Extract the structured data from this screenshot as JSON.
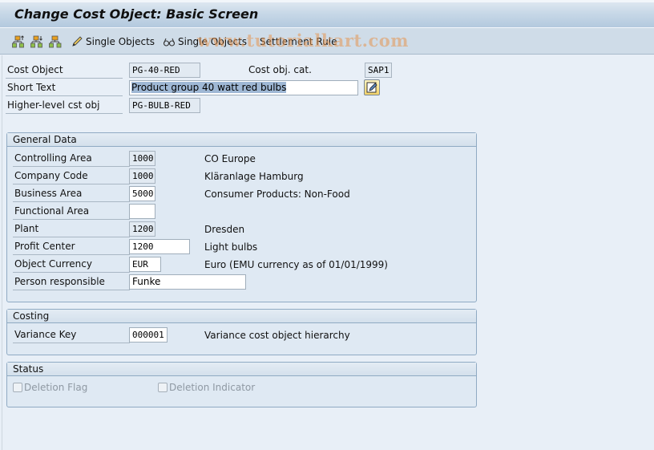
{
  "window": {
    "title": "Change Cost Object: Basic Screen"
  },
  "toolbar": {
    "items": [
      {
        "icon": "hierarchy-up-icon",
        "label": ""
      },
      {
        "icon": "hierarchy-down-icon",
        "label": ""
      },
      {
        "icon": "hierarchy-icon",
        "label": ""
      },
      {
        "icon": "pencil-icon",
        "label": "Single Objects"
      },
      {
        "icon": "glasses-icon",
        "label": "Single Objects"
      },
      {
        "icon": "",
        "label": "Settlement Rule"
      }
    ],
    "watermark": "www.tutorialkart.com"
  },
  "header": {
    "cost_object": {
      "label": "Cost Object",
      "value": "PG-40-RED"
    },
    "cost_obj_cat": {
      "label": "Cost obj. cat.",
      "value": "SAP1"
    },
    "short_text": {
      "label": "Short Text",
      "value": "Product group 40 watt red bulbs"
    },
    "higher_level": {
      "label": "Higher-level cst obj",
      "value": "PG-BULB-RED"
    }
  },
  "general_data": {
    "title": "General Data",
    "rows": [
      {
        "label": "Controlling Area",
        "value": "1000",
        "desc": "CO Europe"
      },
      {
        "label": "Company Code",
        "value": "1000",
        "desc": "Kläranlage Hamburg"
      },
      {
        "label": "Business Area",
        "value": "5000",
        "desc": "Consumer Products: Non-Food"
      },
      {
        "label": "Functional Area",
        "value": "",
        "desc": ""
      },
      {
        "label": "Plant",
        "value": "1200",
        "desc": "Dresden"
      },
      {
        "label": "Profit Center",
        "value": "1200",
        "desc": "Light bulbs"
      },
      {
        "label": "Object Currency",
        "value": "EUR",
        "desc": "Euro (EMU currency as of 01/01/1999)"
      },
      {
        "label": "Person responsible",
        "value": "Funke",
        "desc": ""
      }
    ]
  },
  "costing": {
    "title": "Costing",
    "variance_key": {
      "label": "Variance Key",
      "value": "000001",
      "desc": "Variance cost object hierarchy"
    }
  },
  "status": {
    "title": "Status",
    "deletion_flag": {
      "label": "Deletion Flag",
      "checked": false
    },
    "deletion_indicator": {
      "label": "Deletion Indicator",
      "checked": false
    }
  }
}
